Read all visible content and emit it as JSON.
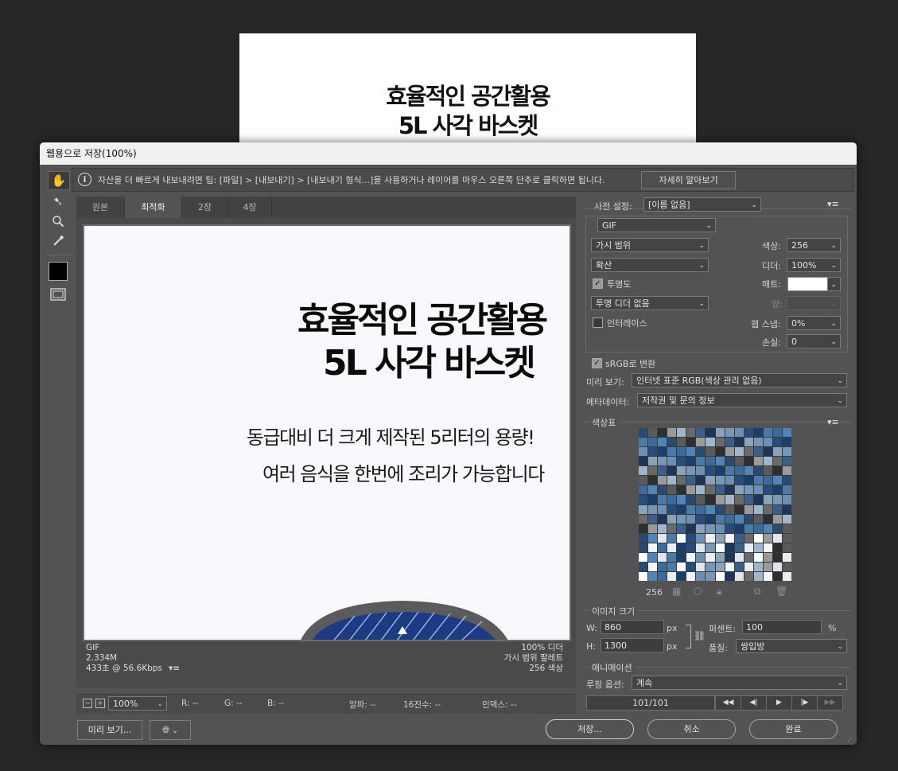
{
  "background_doc": {
    "line1": "효율적인 공간활용",
    "line2": "5L 사각 바스켓"
  },
  "dialog": {
    "title": "웹용으로 저장(100%)",
    "tip": "자산을 더 빠르게 내보내려면 팁: [파일] > [내보내기] > [내보내기 형식...]을 사용하거나 레이어를 마우스 오른쪽 단추로 클릭하면 됩니다.",
    "tip_button": "자세히 알아보기"
  },
  "tabs": [
    "원본",
    "최적화",
    "2장",
    "4장"
  ],
  "active_tab": "최적화",
  "canvas_text": {
    "line1": "효율적인 공간활용",
    "line2": "5L 사각 바스켓",
    "line3": "동급대비 더 크게 제작된 5리터의 용량!",
    "line4": "여러 음식을 한번에 조리가 가능합니다"
  },
  "preview_info": {
    "format": "GIF",
    "size": "2.334M",
    "time": "433초 @ 56.6Kbps",
    "dither": "100% 디더",
    "palette": "가시 범위 팔레트",
    "colors": "256 색상"
  },
  "status_bar": {
    "zoom": "100%",
    "r": "R: --",
    "g": "G: --",
    "b": "B: --",
    "alpha": "알파: --",
    "hex": "16진수: --",
    "index": "인덱스: --"
  },
  "buttons": {
    "preview": "미리 보기...",
    "save": "저장...",
    "cancel": "취소",
    "done": "완료"
  },
  "settings": {
    "preset_label": "사전 설정:",
    "preset_value": "[이름 없음]",
    "format": "GIF",
    "reduction": "가시 범위",
    "dither_algo": "확산",
    "transparency_label": "투명도",
    "transparency_checked": true,
    "transparency_dither": "투명 디더 없음",
    "interlace_label": "인터레이스",
    "interlace_checked": false,
    "colors_label": "색상:",
    "colors_value": "256",
    "dither_label": "디더:",
    "dither_value": "100%",
    "matte_label": "매트:",
    "amount_label": "양:",
    "websnap_label": "웹 스냅:",
    "websnap_value": "0%",
    "lossy_label": "손실:",
    "lossy_value": "0",
    "srgb_label": "sRGB로 변환",
    "srgb_checked": true,
    "preview_label": "미리 보기:",
    "preview_value": "인터넷 표준 RGB(색상 관리 없음)",
    "metadata_label": "메타데이터:",
    "metadata_value": "저작권 및 문의 정보"
  },
  "color_table": {
    "title": "색상표",
    "count": "256",
    "colors": [
      "#2b4a6f",
      "#4a7aa8",
      "#6d8fb3",
      "#1e3558",
      "#9fb6cc",
      "#5a5a5a",
      "#3c6a9a",
      "#274d7e",
      "#8aa3bd",
      "#6a6a6a",
      "#2e2e2e",
      "#4e86bb",
      "#1b3f6d",
      "#7797b7",
      "#3a5f8a",
      "#9a9a9a"
    ]
  },
  "image_size": {
    "title": "이미지 크기",
    "w_label": "W:",
    "w_value": "860",
    "h_label": "H:",
    "h_value": "1300",
    "unit": "px",
    "percent_label": "퍼센트:",
    "percent_value": "100",
    "percent_unit": "%",
    "quality_label": "품질:",
    "quality_value": "쌍입방"
  },
  "animation": {
    "title": "애니메이션",
    "loop_label": "루핑 옵션:",
    "loop_value": "계속",
    "frame": "101/101"
  }
}
